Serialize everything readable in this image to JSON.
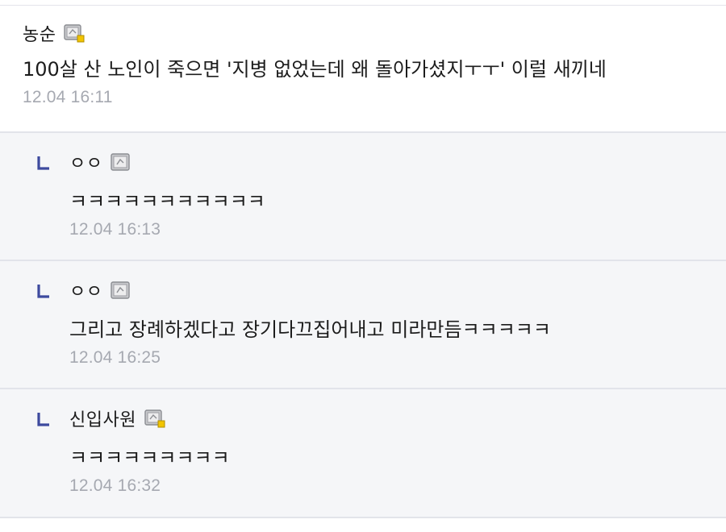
{
  "comments": [
    {
      "author": "농순",
      "text": "100살 산 노인이 죽으면 '지병 없었는데 왜 돌아가셨지ㅜㅜ' 이럴 새끼네",
      "time": "12.04 16:11",
      "icon": "mobile-badge-icon",
      "icon_dot": true
    },
    {
      "author": "ㅇㅇ",
      "text": "ㅋㅋㅋㅋㅋㅋㅋㅋㅋㅋㅋ",
      "time": "12.04 16:13",
      "icon": "mobile-icon",
      "icon_dot": false
    },
    {
      "author": "ㅇㅇ",
      "text": "그리고 장례하겠다고 장기다끄집어내고 미라만듬ㅋㅋㅋㅋㅋ",
      "time": "12.04 16:25",
      "icon": "mobile-icon",
      "icon_dot": false
    },
    {
      "author": "신입사원",
      "text": "ㅋㅋㅋㅋㅋㅋㅋㅋㅋ",
      "time": "12.04 16:32",
      "icon": "mobile-badge-icon",
      "icon_dot": true
    }
  ],
  "colors": {
    "reply_arrow": "#3d4a9e",
    "timestamp": "#a6a9b1",
    "reply_bg": "#f5f6f8",
    "badge_dot": "#f2c400"
  }
}
